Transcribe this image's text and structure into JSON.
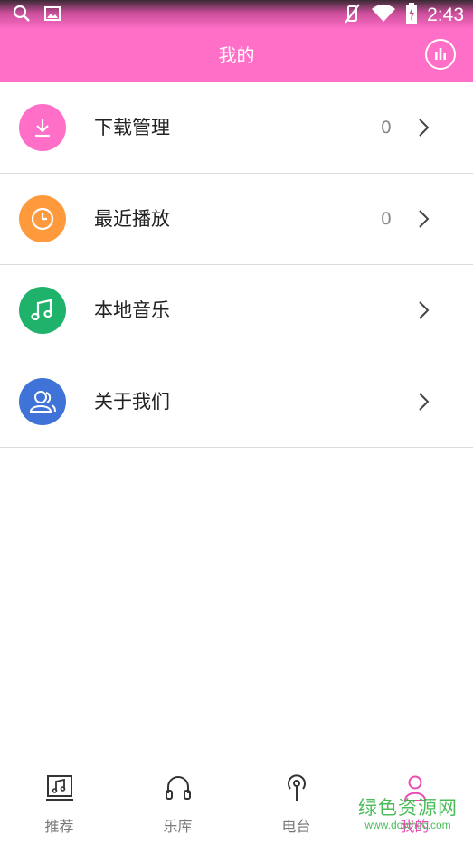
{
  "status_bar": {
    "time": "2:43",
    "icons": [
      "search-icon",
      "image-icon",
      "vibrate-off-icon",
      "wifi-icon",
      "battery-charging-icon"
    ]
  },
  "header": {
    "title": "我的",
    "action_icon": "equalizer-icon"
  },
  "menu": {
    "items": [
      {
        "label": "下载管理",
        "count": "0",
        "icon": "download-icon",
        "color": "#ff6ec7"
      },
      {
        "label": "最近播放",
        "count": "0",
        "icon": "clock-icon",
        "color": "#ff9a3c"
      },
      {
        "label": "本地音乐",
        "count": "",
        "icon": "music-note-icon",
        "color": "#1fb26a"
      },
      {
        "label": "关于我们",
        "count": "",
        "icon": "users-icon",
        "color": "#3f73d8"
      }
    ]
  },
  "bottom_nav": {
    "items": [
      {
        "label": "推荐",
        "icon": "music-album-icon"
      },
      {
        "label": "乐库",
        "icon": "headphones-icon"
      },
      {
        "label": "电台",
        "icon": "radio-icon"
      },
      {
        "label": "我的",
        "icon": "user-icon",
        "active": true
      }
    ]
  },
  "watermark": {
    "main": "绿色资源网",
    "sub": "www.downcc.com"
  },
  "colors": {
    "accent": "#ff6ec7",
    "active_tab": "#e94cb3",
    "watermark": "#39b54a"
  }
}
